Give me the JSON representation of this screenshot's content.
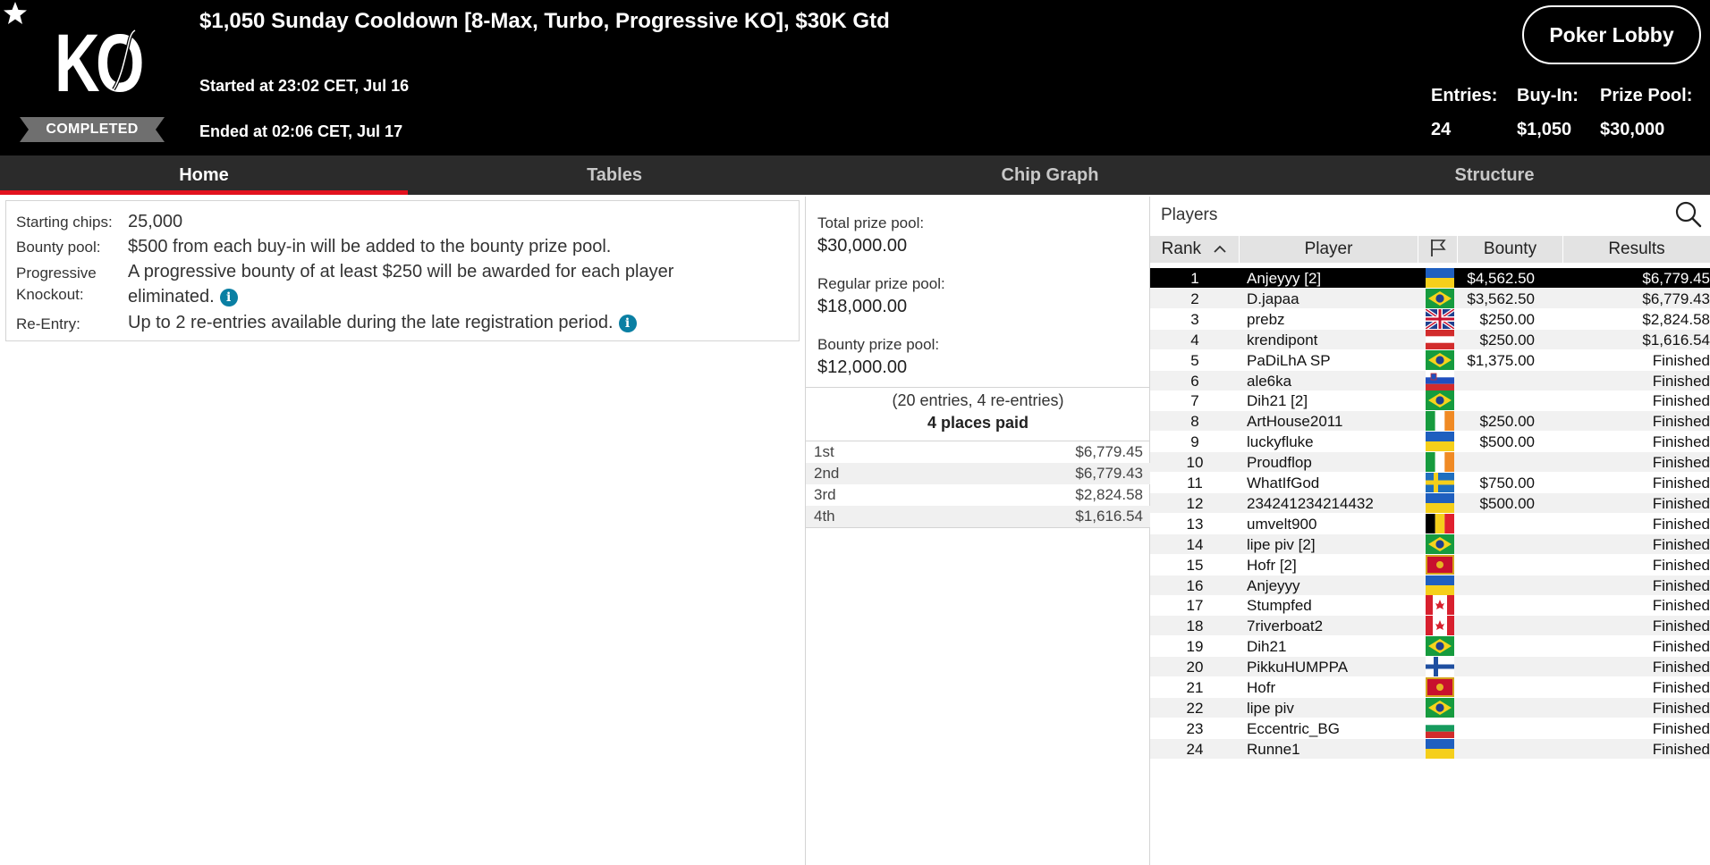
{
  "header": {
    "title": "$1,050 Sunday Cooldown [8-Max, Turbo, Progressive KO], $30K Gtd",
    "started": "Started at 23:02 CET, Jul 16",
    "ended": "Ended at 02:06 CET, Jul 17",
    "status": "COMPLETED",
    "lobby_button": "Poker Lobby",
    "favorite_icon": "star-icon",
    "logo_text": "KO",
    "stats": {
      "entries_label": "Entries:",
      "entries_value": "24",
      "buyin_label": "Buy-In:",
      "buyin_value": "$1,050",
      "prizepool_label": "Prize Pool:",
      "prizepool_value": "$30,000"
    }
  },
  "tabs": [
    {
      "label": "Home",
      "active": true
    },
    {
      "label": "Tables",
      "active": false
    },
    {
      "label": "Chip Graph",
      "active": false
    },
    {
      "label": "Structure",
      "active": false
    }
  ],
  "info": {
    "starting_chips_label": "Starting chips:",
    "starting_chips_value": "25,000",
    "bounty_pool_label": "Bounty pool:",
    "bounty_pool_value": "$500 from each buy-in will be added to the bounty prize pool.",
    "progressive_label_1": "Progressive",
    "progressive_label_2": "Knockout:",
    "progressive_value_1": "A progressive bounty of at least $250 will be awarded for each player",
    "progressive_value_2": "eliminated.",
    "reentry_label": "Re-Entry:",
    "reentry_value": "Up to 2 re-entries available during the late registration period.",
    "info_icon_glyph": "i"
  },
  "prize": {
    "total_label": "Total prize pool:",
    "total_value": "$30,000.00",
    "regular_label": "Regular prize pool:",
    "regular_value": "$18,000.00",
    "bounty_label": "Bounty prize pool:",
    "bounty_value": "$12,000.00",
    "entries_note": "(20 entries, 4 re-entries)",
    "places_paid": "4 places paid",
    "payouts": [
      {
        "place": "1st",
        "amount": "$6,779.45"
      },
      {
        "place": "2nd",
        "amount": "$6,779.43"
      },
      {
        "place": "3rd",
        "amount": "$2,824.58"
      },
      {
        "place": "4th",
        "amount": "$1,616.54"
      }
    ]
  },
  "players": {
    "title": "Players",
    "columns": {
      "rank": "Rank",
      "player": "Player",
      "bounty": "Bounty",
      "results": "Results"
    },
    "flag_column_icon": "flag-icon",
    "sort_icon": "chevron-up-icon",
    "rows": [
      {
        "rank": "1",
        "name": "Anjeyyy [2]",
        "flag": "ua",
        "bounty": "$4,562.50",
        "result": "$6,779.45"
      },
      {
        "rank": "2",
        "name": "D.japaa",
        "flag": "br",
        "bounty": "$3,562.50",
        "result": "$6,779.43"
      },
      {
        "rank": "3",
        "name": "prebz",
        "flag": "gb",
        "bounty": "$250.00",
        "result": "$2,824.58"
      },
      {
        "rank": "4",
        "name": "krendipont",
        "flag": "at",
        "bounty": "$250.00",
        "result": "$1,616.54"
      },
      {
        "rank": "5",
        "name": "PaDiLhA SP",
        "flag": "br",
        "bounty": "$1,375.00",
        "result": "Finished"
      },
      {
        "rank": "6",
        "name": "ale6ka",
        "flag": "si",
        "bounty": "",
        "result": "Finished"
      },
      {
        "rank": "7",
        "name": "Dih21 [2]",
        "flag": "br",
        "bounty": "",
        "result": "Finished"
      },
      {
        "rank": "8",
        "name": "ArtHouse2011",
        "flag": "ie",
        "bounty": "$250.00",
        "result": "Finished"
      },
      {
        "rank": "9",
        "name": "luckyfluke",
        "flag": "ua",
        "bounty": "$500.00",
        "result": "Finished"
      },
      {
        "rank": "10",
        "name": "Proudflop",
        "flag": "ie",
        "bounty": "",
        "result": "Finished"
      },
      {
        "rank": "11",
        "name": "WhatIfGod",
        "flag": "se",
        "bounty": "$750.00",
        "result": "Finished"
      },
      {
        "rank": "12",
        "name": "234241234214432",
        "flag": "ua",
        "bounty": "$500.00",
        "result": "Finished"
      },
      {
        "rank": "13",
        "name": "umvelt900",
        "flag": "be",
        "bounty": "",
        "result": "Finished"
      },
      {
        "rank": "14",
        "name": "lipe piv [2]",
        "flag": "br",
        "bounty": "",
        "result": "Finished"
      },
      {
        "rank": "15",
        "name": "Hofr [2]",
        "flag": "me",
        "bounty": "",
        "result": "Finished"
      },
      {
        "rank": "16",
        "name": "Anjeyyy",
        "flag": "ua",
        "bounty": "",
        "result": "Finished"
      },
      {
        "rank": "17",
        "name": "Stumpfed",
        "flag": "ca",
        "bounty": "",
        "result": "Finished"
      },
      {
        "rank": "18",
        "name": "7riverboat2",
        "flag": "ca",
        "bounty": "",
        "result": "Finished"
      },
      {
        "rank": "19",
        "name": "Dih21",
        "flag": "br",
        "bounty": "",
        "result": "Finished"
      },
      {
        "rank": "20",
        "name": "PikkuHUMPPA",
        "flag": "fi",
        "bounty": "",
        "result": "Finished"
      },
      {
        "rank": "21",
        "name": "Hofr",
        "flag": "me",
        "bounty": "",
        "result": "Finished"
      },
      {
        "rank": "22",
        "name": "lipe piv",
        "flag": "br",
        "bounty": "",
        "result": "Finished"
      },
      {
        "rank": "23",
        "name": "Eccentric_BG",
        "flag": "bg",
        "bounty": "",
        "result": "Finished"
      },
      {
        "rank": "24",
        "name": "Runne1",
        "flag": "ua",
        "bounty": "",
        "result": "Finished"
      }
    ]
  },
  "colors": {
    "header_bg": "#000000",
    "tab_bar_bg": "#2b2b2b",
    "active_tab_underline": "#e2121e",
    "info_icon": "#0a7fa3",
    "selected_row_bg": "#000000"
  }
}
